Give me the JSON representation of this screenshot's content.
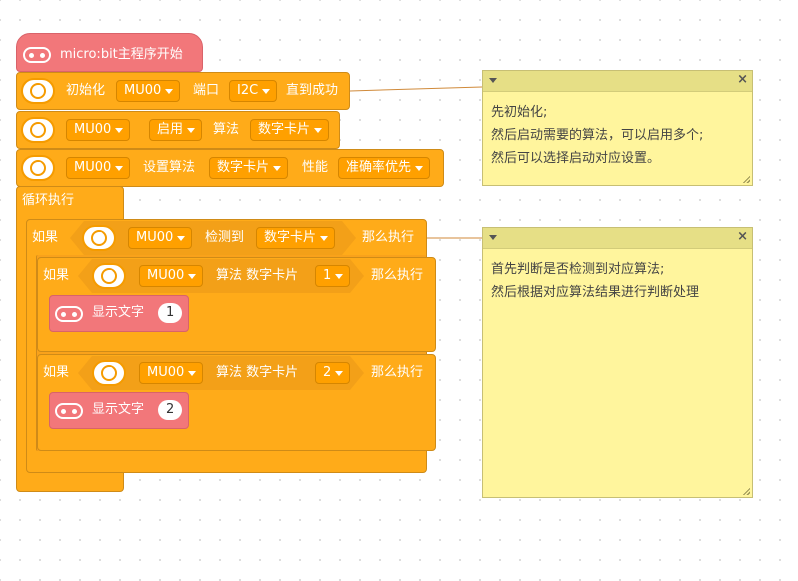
{
  "blocks": {
    "main": {
      "label": "micro:bit主程序开始"
    },
    "init": {
      "label": "初始化",
      "device": "MU00",
      "port_label": "端口",
      "port": "I2C",
      "suffix": "直到成功"
    },
    "enable": {
      "device": "MU00",
      "mode": "启用",
      "algo_label": "算法",
      "algo": "数字卡片"
    },
    "config": {
      "device": "MU00",
      "set_label": "设置算法",
      "algo": "数字卡片",
      "perf_label": "性能",
      "perf": "准确率优先"
    },
    "loop": {
      "label": "循环执行"
    },
    "if1": {
      "if_label": "如果",
      "device": "MU00",
      "detect_label": "检测到",
      "algo": "数字卡片",
      "then_label": "那么执行"
    },
    "if2": {
      "if_label": "如果",
      "device": "MU00",
      "algo_text": "算法 数字卡片",
      "value": "1",
      "then_label": "那么执行"
    },
    "show1": {
      "label": "显示文字",
      "value": "1"
    },
    "if3": {
      "if_label": "如果",
      "device": "MU00",
      "algo_text": "算法 数字卡片",
      "value": "2",
      "then_label": "那么执行"
    },
    "show2": {
      "label": "显示文字",
      "value": "2"
    }
  },
  "comments": [
    {
      "lines": [
        "先初始化;",
        "然后启动需要的算法，可以启用多个;",
        "然后可以选择启动对应设置。"
      ]
    },
    {
      "lines": [
        "首先判断是否检测到对应算法;",
        "然后根据对应算法结果进行判断处理"
      ]
    }
  ],
  "colors": {
    "block_orange": "#ffab19",
    "block_pink": "#f2777a",
    "comment_yellow": "#fff59d"
  }
}
